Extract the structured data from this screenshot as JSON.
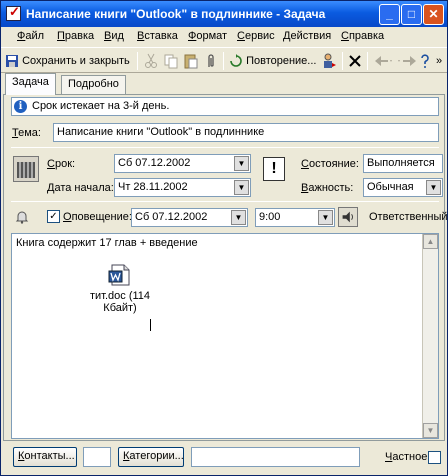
{
  "window": {
    "title": "Написание книги \"Outlook\" в подлиннике - Задача",
    "minimize": "_",
    "maximize": "□",
    "close": "✕"
  },
  "menu": [
    "Файл",
    "Правка",
    "Вид",
    "Вставка",
    "Формат",
    "Сервис",
    "Действия",
    "Справка"
  ],
  "toolbar": {
    "save_close": "Сохранить и закрыть",
    "recurrence": "Повторение...",
    "more": "»"
  },
  "tabs": [
    "Задача",
    "Подробно"
  ],
  "info": {
    "text": "Срок истекает на 3-й день."
  },
  "subject": {
    "label": "Тема:",
    "value": "Написание книги \"Outlook\" в подлиннике"
  },
  "due": {
    "label": "Срок:",
    "value": "Сб 07.12.2002"
  },
  "start": {
    "label": "Дата начала:",
    "value": "Чт 28.11.2002"
  },
  "status": {
    "label": "Состояние:",
    "value": "Выполняется"
  },
  "priority": {
    "label": "Важность:",
    "value": "Обычная",
    "icon_glyph": "!"
  },
  "reminder": {
    "checkbox_mark": "✓",
    "label": "Оповещение:",
    "date": "Сб 07.12.2002",
    "time": "9:00",
    "owner_label": "Ответственный"
  },
  "notes": {
    "text": "Книга содержит 17 глав + введение",
    "attachment": "тит.doc (114 Кбайт)"
  },
  "bottom": {
    "contacts_button": "Контакты...",
    "categories_button": "Категории...",
    "private_label": "Частное"
  },
  "colors": {
    "title_bar": "#0a5be0",
    "close_button": "#d9531f",
    "info_icon": "#2060c0"
  }
}
